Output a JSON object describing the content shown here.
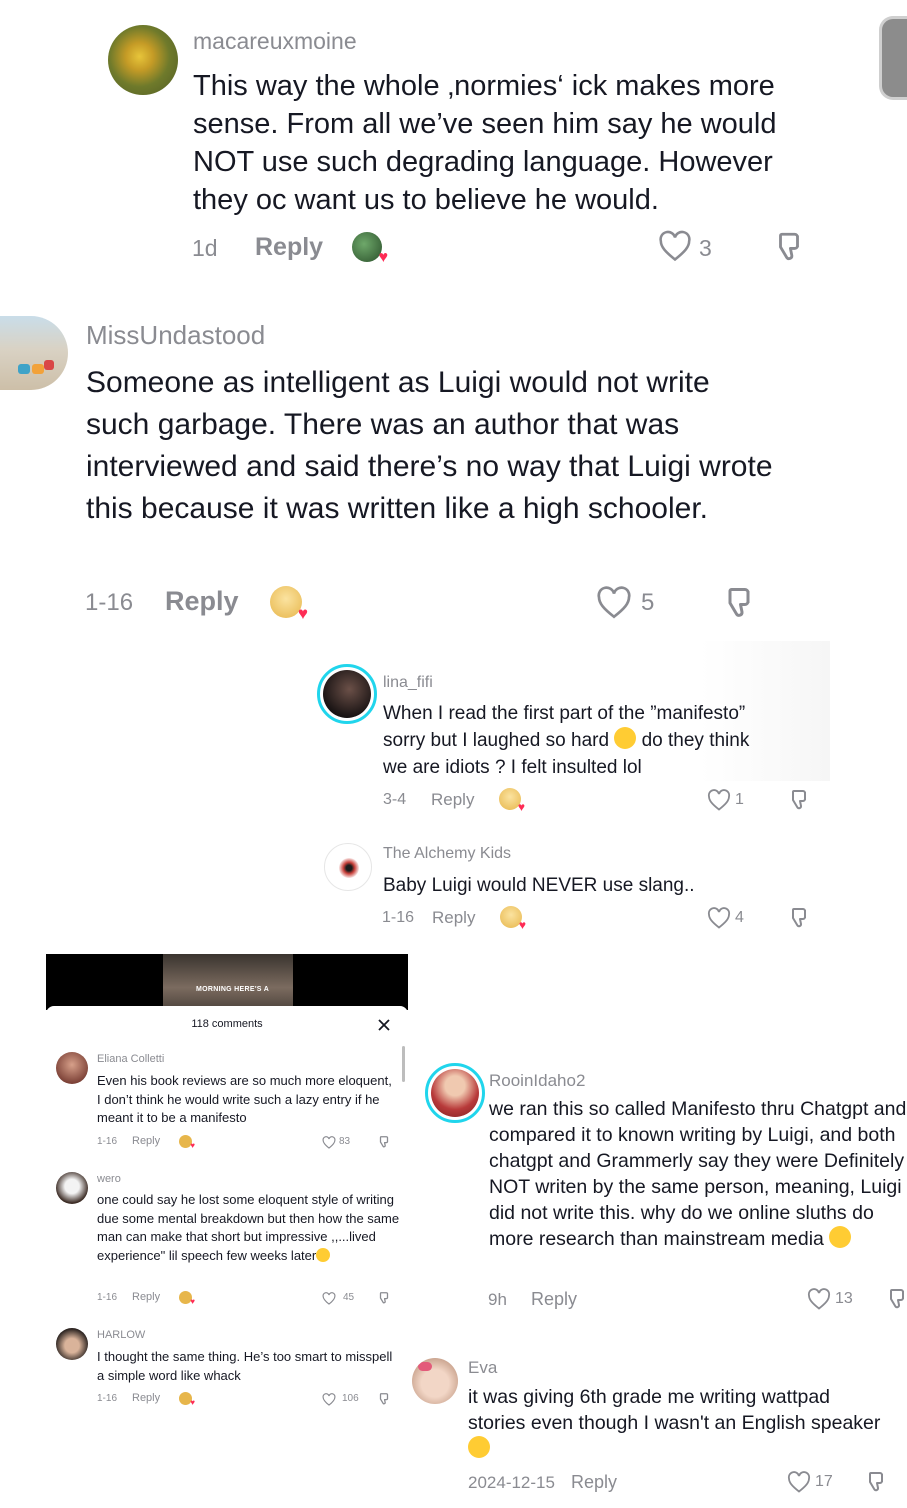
{
  "comments": [
    {
      "username": "macareuxmoine",
      "text": "This way the whole ‚normies‘ ick makes more sense. From all we’ve seen him say he would NOT use such degrading language. However they oc want us to believe he would.",
      "date": "1d",
      "reply_label": "Reply",
      "likes": "3"
    },
    {
      "username": "MissUndastood",
      "text": "Someone as intelligent as Luigi would not write such garbage. There was an author that was interviewed and said there’s no way that Luigi wrote this because it was written like a high schooler.",
      "date": "1-16",
      "reply_label": "Reply",
      "likes": "5"
    },
    {
      "username": "lina_fifi",
      "text_line1": "When I read the first part of the ”manifesto”",
      "text_line2a": "sorry but I laughed so hard",
      "text_line2b": "do they think",
      "text_line3": "we are idiots ? I felt insulted lol",
      "date": "3-4",
      "reply_label": "Reply",
      "likes": "1"
    },
    {
      "username": "The Alchemy Kids",
      "text": "Baby Luigi would NEVER use slang..",
      "date": "1-16",
      "reply_label": "Reply",
      "likes": "4"
    },
    {
      "username": "RooinIdaho2",
      "text": "we ran this so called Manifesto thru Chatgpt and compared it to known writing by Luigi, and both chatgpt and Grammerly say they were Definitely NOT writen by the same person, meaning, Luigi did not write this. why do we online sluths do more research than mainstream media",
      "date": "9h",
      "reply_label": "Reply",
      "likes": "13"
    },
    {
      "username": "Eva",
      "text": "it was giving 6th grade me writing wattpad stories even though I wasn't an English speaker",
      "date": "2024-12-15",
      "reply_label": "Reply",
      "likes": "17"
    }
  ],
  "embedded": {
    "video_caption": "MORNING HERE'S A",
    "comment_count": "118 comments",
    "comments": [
      {
        "username": "Eliana Colletti",
        "text": "Even his book reviews are so much more eloquent, I don’t think he would write such a lazy entry if he meant it to be a manifesto",
        "date": "1-16",
        "reply_label": "Reply",
        "likes": "83"
      },
      {
        "username": "wero",
        "text": "one could say he lost some eloquent style of writing due some mental breakdown but then how the same man can make that short but impressive ,,...lived experience\" lil speech few weeks later",
        "date": "1-16",
        "reply_label": "Reply",
        "likes": "45"
      },
      {
        "username": "HARLOW",
        "text": "I thought the same thing. He’s too smart to misspell a simple word like whack",
        "date": "1-16",
        "reply_label": "Reply",
        "likes": "106"
      }
    ]
  },
  "colors": {
    "text": "#161823",
    "muted": "#8a8b91",
    "heart": "#fe2c55",
    "ring": "#20d5ec"
  },
  "icons": [
    "heart-outline-icon",
    "dislike-icon",
    "close-icon",
    "creator-liked-badge",
    "laughing-emoji",
    "thinking-emoji",
    "crying-emoji",
    "slight-smile-emoji"
  ]
}
